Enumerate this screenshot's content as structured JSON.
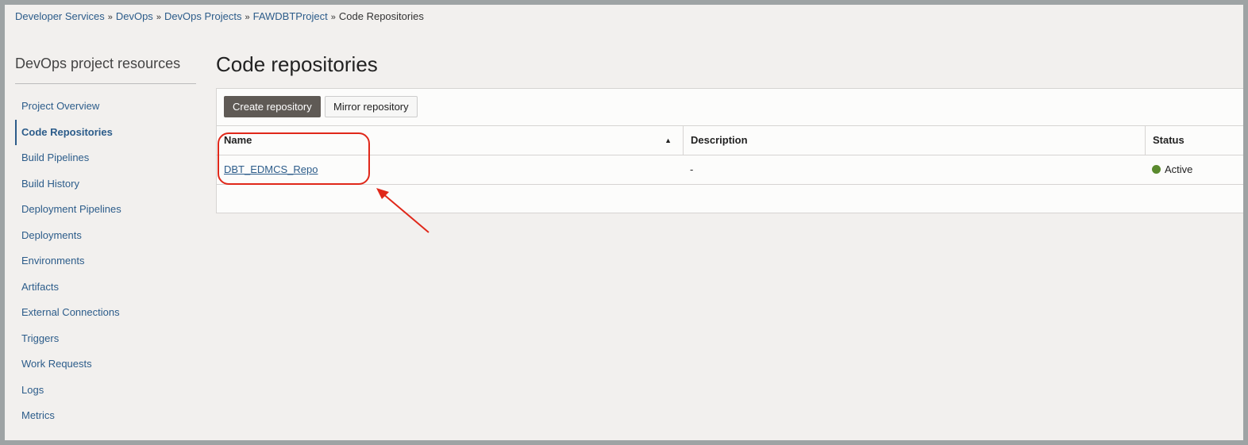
{
  "breadcrumb": [
    "Developer Services",
    "DevOps",
    "DevOps Projects",
    "FAWDBTProject",
    "Code Repositories"
  ],
  "breadcrumb_sep": "»",
  "sidebar": {
    "title": "DevOps project resources",
    "items": [
      {
        "label": "Project Overview"
      },
      {
        "label": "Code Repositories",
        "active": true
      },
      {
        "label": "Build Pipelines"
      },
      {
        "label": "Build History"
      },
      {
        "label": "Deployment Pipelines"
      },
      {
        "label": "Deployments"
      },
      {
        "label": "Environments"
      },
      {
        "label": "Artifacts"
      },
      {
        "label": "External Connections"
      },
      {
        "label": "Triggers"
      },
      {
        "label": "Work Requests"
      },
      {
        "label": "Logs"
      },
      {
        "label": "Metrics"
      }
    ]
  },
  "main": {
    "title": "Code repositories",
    "create_label": "Create repository",
    "mirror_label": "Mirror repository",
    "columns": {
      "name": "Name",
      "description": "Description",
      "status": "Status"
    },
    "rows": [
      {
        "name": "DBT_EDMCS_Repo",
        "description": "-",
        "status": "Active"
      }
    ]
  },
  "colors": {
    "accent": "#2c5c8a",
    "active_status": "#5a8a2e",
    "callout": "#e0281a"
  }
}
